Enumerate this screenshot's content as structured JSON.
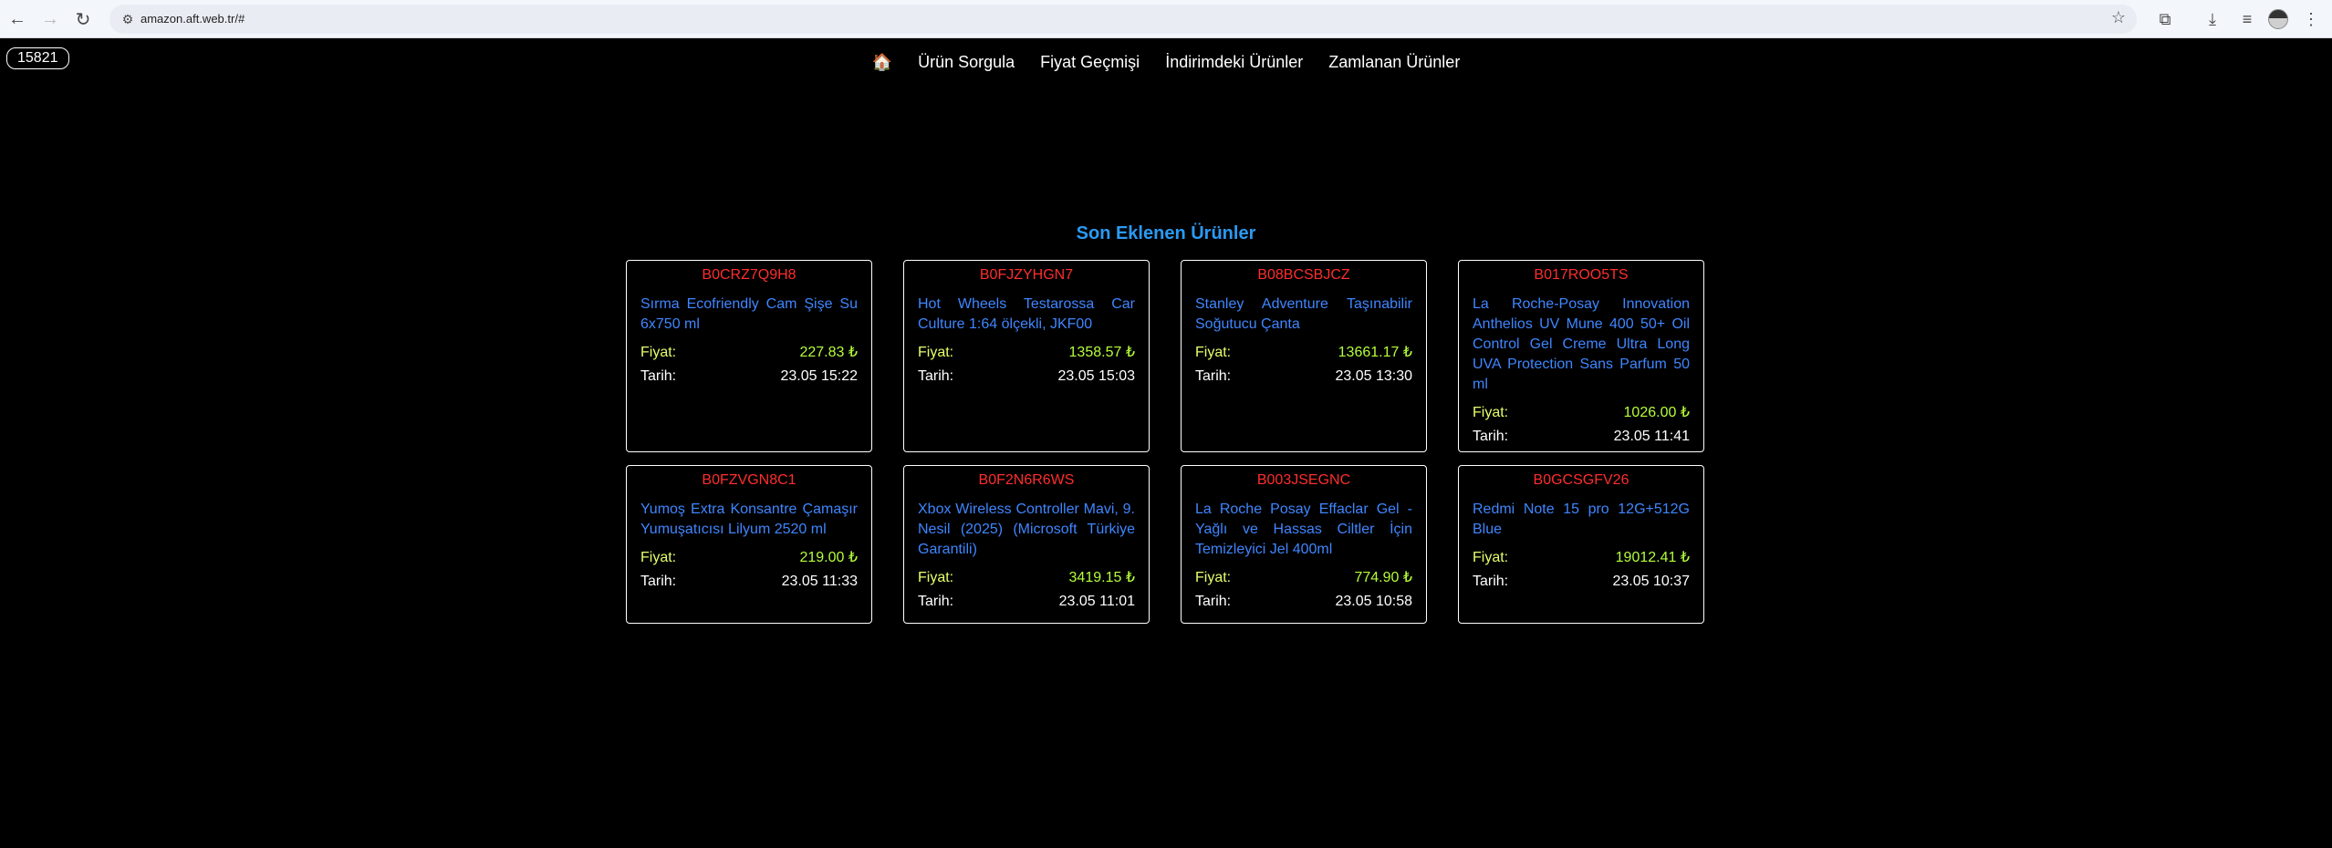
{
  "browser": {
    "url": "amazon.aft.web.tr/#"
  },
  "counter": "15821",
  "nav": {
    "home_icon": "🏠",
    "items": [
      "Ürün Sorgula",
      "Fiyat Geçmişi",
      "İndirimdeki Ürünler",
      "Zamlanan Ürünler"
    ]
  },
  "section_title": "Son Eklenen Ürünler",
  "labels": {
    "price": "Fiyat:",
    "date": "Tarih:"
  },
  "products": [
    {
      "id": "B0CRZ7Q9H8",
      "name": "Sırma Ecofriendly Cam Şişe Su 6x750 ml",
      "price": "227.83 ₺",
      "date": "23.05 15:22"
    },
    {
      "id": "B0FJZYHGN7",
      "name": "Hot Wheels Testarossa Car Culture 1:64 ölçekli, JKF00",
      "price": "1358.57 ₺",
      "date": "23.05 15:03"
    },
    {
      "id": "B08BCSBJCZ",
      "name": "Stanley Adventure Taşınabilir Soğutucu Çanta",
      "price": "13661.17 ₺",
      "date": "23.05 13:30"
    },
    {
      "id": "B017ROO5TS",
      "name": "La Roche-Posay Innovation Anthelios UV Mune 400 50+ Oil Control Gel Creme Ultra Long UVA Protection Sans Parfum 50 ml",
      "price": "1026.00 ₺",
      "date": "23.05 11:41"
    },
    {
      "id": "B0FZVGN8C1",
      "name": "Yumoş Extra Konsantre Çamaşır Yumuşatıcısı Lilyum 2520 ml",
      "price": "219.00 ₺",
      "date": "23.05 11:33"
    },
    {
      "id": "B0F2N6R6WS",
      "name": "Xbox Wireless Controller Mavi, 9. Nesil (2025) (Microsoft Türkiye Garantili)",
      "price": "3419.15 ₺",
      "date": "23.05 11:01"
    },
    {
      "id": "B003JSEGNC",
      "name": "La Roche Posay Effaclar Gel - Yağlı ve Hassas Ciltler İçin Temizleyici Jel 400ml",
      "price": "774.90 ₺",
      "date": "23.05 10:58"
    },
    {
      "id": "B0GCSGFV26",
      "name": "Redmi Note 15 pro 12G+512G Blue",
      "price": "19012.41 ₺",
      "date": "23.05 10:37"
    }
  ],
  "colors": {
    "background": "#000000",
    "accent_title": "#2b9af3",
    "product_id": "#ff2d2d",
    "product_name": "#3f86ff",
    "price": "#b6ff3a"
  }
}
